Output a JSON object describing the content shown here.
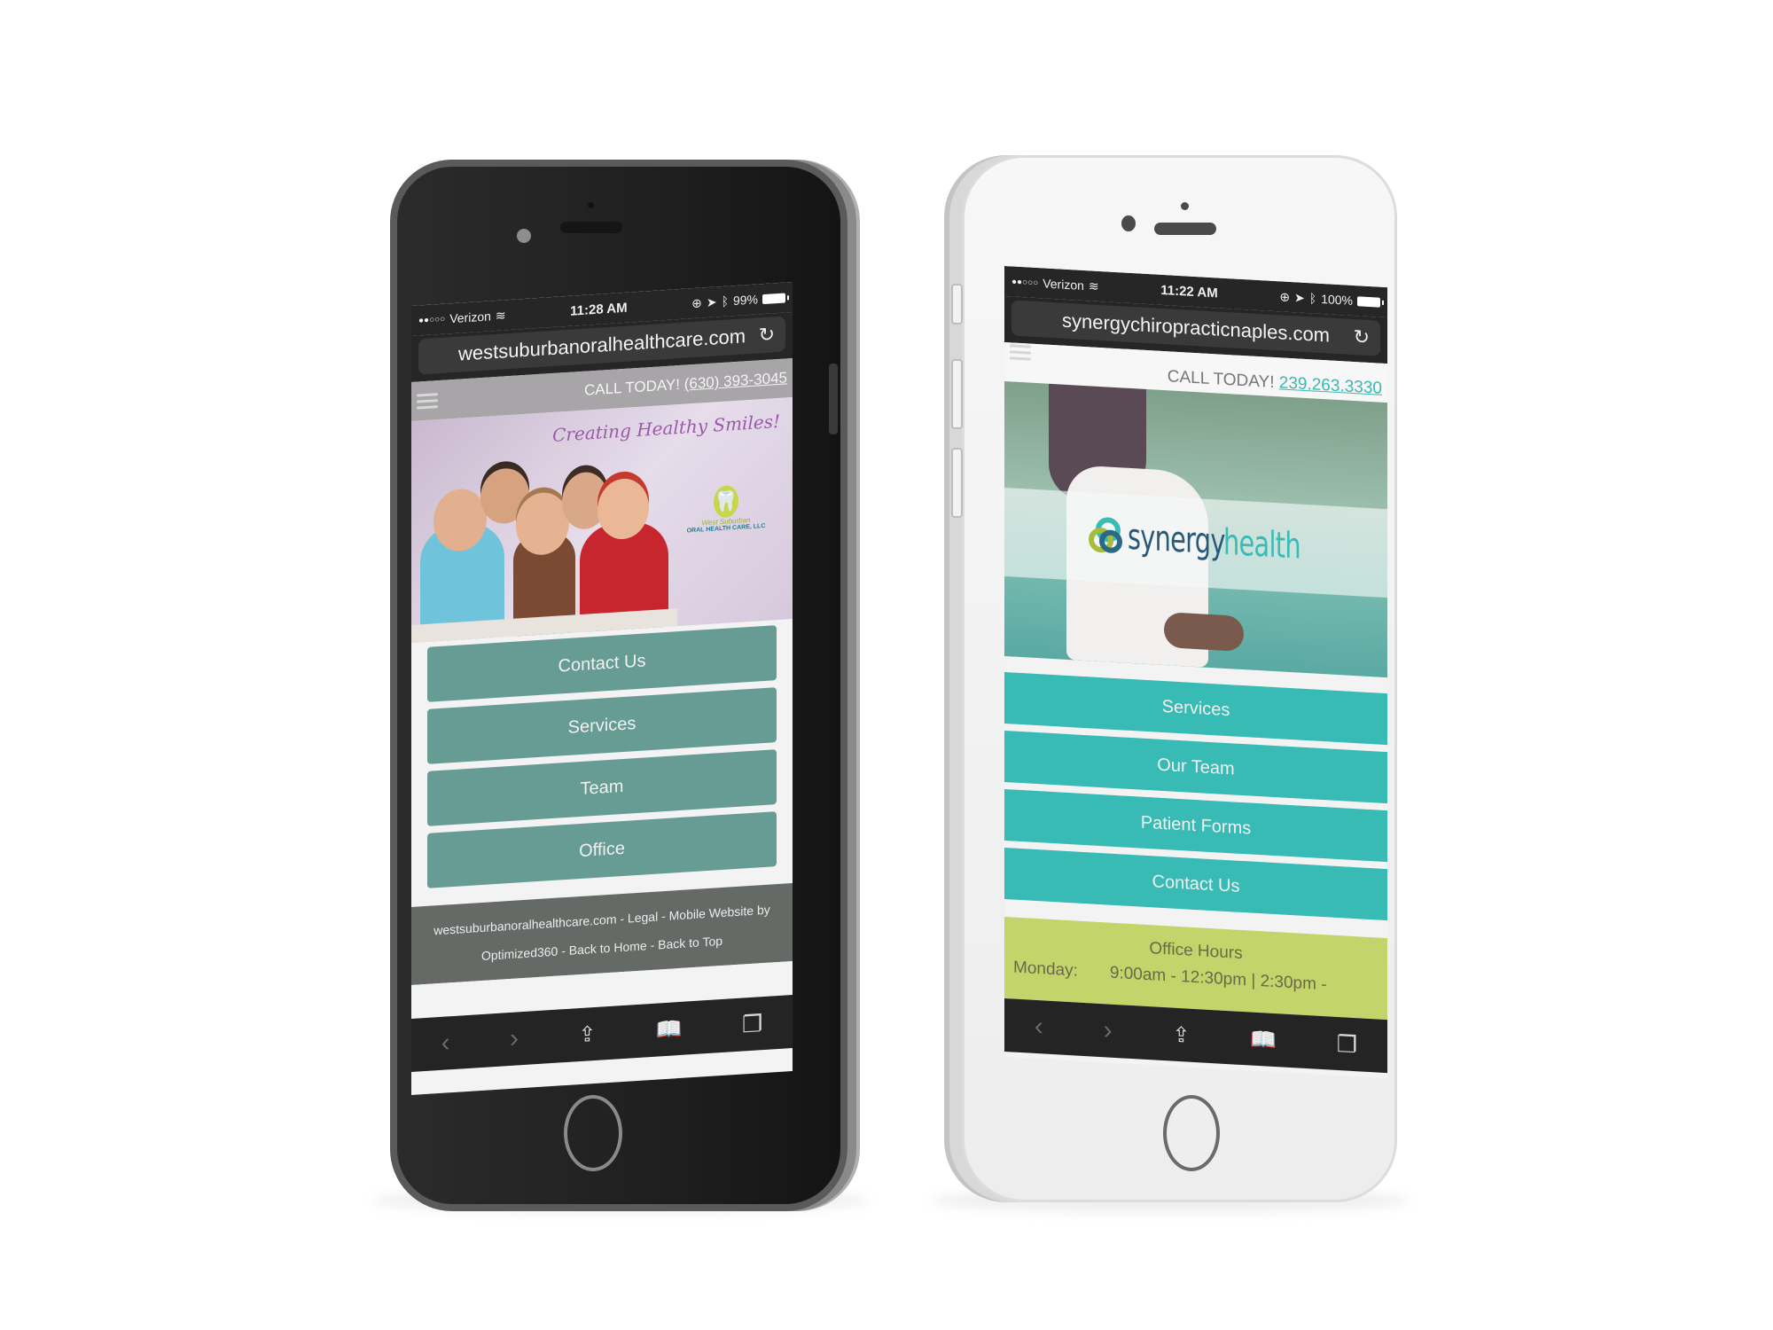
{
  "phones": [
    {
      "id": "dark",
      "status": {
        "signal": "●●○○○",
        "carrier": "Verizon",
        "wifi_icon": "wifi-icon",
        "time": "11:28 AM",
        "battery": "99%"
      },
      "url": "westsuburbanoralhealthcare.com",
      "call_label": "CALL TODAY!",
      "phone_number": "(630) 393-3045",
      "hero": {
        "tagline": "Creating Healthy Smiles!",
        "logo_top": "West Suburban",
        "logo_bottom": "ORAL HEALTH CARE, LLC"
      },
      "nav": [
        "Contact Us",
        "Services",
        "Team",
        "Office"
      ],
      "footer": {
        "line1": "westsuburbanoralhealthcare.com - Legal - Mobile Website by",
        "line2": "Optimized360 - Back to Home - Back to Top"
      },
      "colors": {
        "button": "#669c93",
        "callbar": "#a8a5a8",
        "footer": "#666a67"
      }
    },
    {
      "id": "light",
      "status": {
        "signal": "●●○○○",
        "carrier": "Verizon",
        "wifi_icon": "wifi-icon",
        "time": "11:22 AM",
        "battery": "100%"
      },
      "url": "synergychiropracticnaples.com",
      "call_label": "CALL TODAY!",
      "phone_number": "239.263.3330",
      "hero": {
        "logo_part1": "synergy",
        "logo_part2": "health"
      },
      "nav": [
        "Services",
        "Our Team",
        "Patient Forms",
        "Contact Us"
      ],
      "office_hours": {
        "title": "Office Hours",
        "day": "Monday:",
        "hours": "9:00am - 12:30pm | 2:30pm -"
      },
      "colors": {
        "button": "#39bbb5",
        "link": "#3bb8b2",
        "hours_bg": "#c3d46a"
      }
    }
  ],
  "toolbar_icons": [
    "back-icon",
    "forward-icon",
    "share-icon",
    "bookmarks-icon",
    "tabs-icon"
  ]
}
